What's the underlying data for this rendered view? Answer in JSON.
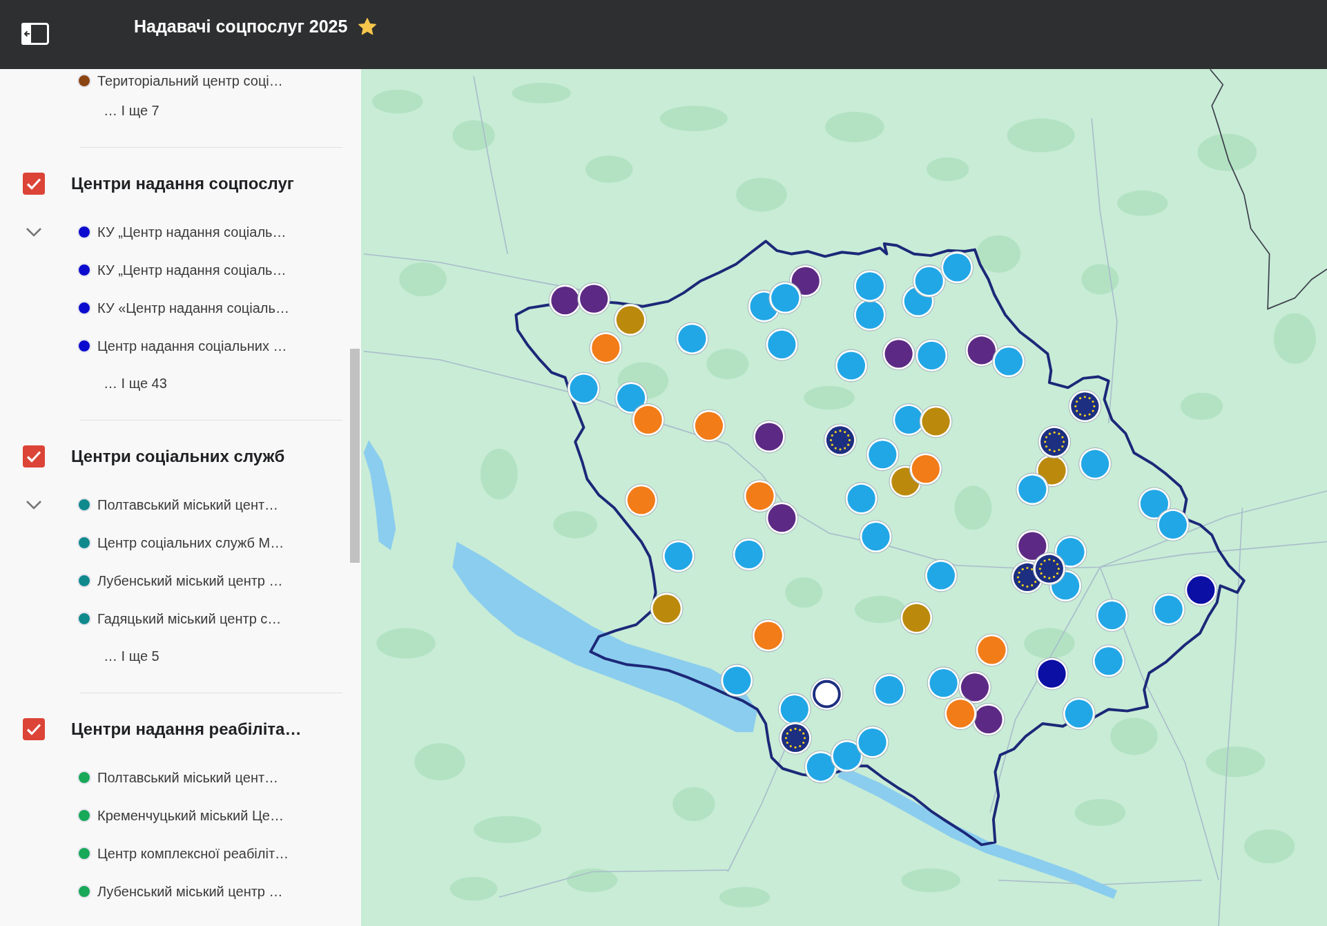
{
  "header": {
    "title": "Надавачі соцпослуг 2025",
    "starred": true
  },
  "sections": [
    {
      "items": [
        {
          "text": "Територіальний центр соці…",
          "color": "#8b4513",
          "toggle": false
        }
      ],
      "more": "… І ще 7"
    },
    {
      "title": "Центри надання соцпослуг",
      "checked": true,
      "items": [
        {
          "text": "КУ „Центр надання соціаль…",
          "color": "#0b0bcf",
          "toggle": true
        },
        {
          "text": "КУ „Центр надання соціаль…",
          "color": "#0b0bcf",
          "toggle": false
        },
        {
          "text": "КУ «Центр надання соціаль…",
          "color": "#0b0bcf",
          "toggle": false
        },
        {
          "text": "Центр надання соціальних …",
          "color": "#0b0bcf",
          "toggle": false
        }
      ],
      "more": "… І ще 43"
    },
    {
      "title": "Центри соціальних служб",
      "checked": true,
      "items": [
        {
          "text": "Полтавський міський цент…",
          "color": "#10898c",
          "toggle": true
        },
        {
          "text": "Центр соціальних служб М…",
          "color": "#10898c",
          "toggle": false
        },
        {
          "text": "Лубенський міський центр …",
          "color": "#10898c",
          "toggle": false
        },
        {
          "text": "Гадяцький міський центр с…",
          "color": "#10898c",
          "toggle": false
        }
      ],
      "more": "… І ще 5"
    },
    {
      "title": "Центри надання реабіліта…",
      "checked": true,
      "items": [
        {
          "text": "Полтавський міський цент…",
          "color": "#17a858",
          "toggle": false
        },
        {
          "text": "Кременчуцький міський Це…",
          "color": "#17a858",
          "toggle": false
        },
        {
          "text": "Центр комплексної реабіліт…",
          "color": "#17a858",
          "toggle": false
        },
        {
          "text": "Лубенський міський центр …",
          "color": "#17a858",
          "toggle": false
        }
      ]
    }
  ]
}
